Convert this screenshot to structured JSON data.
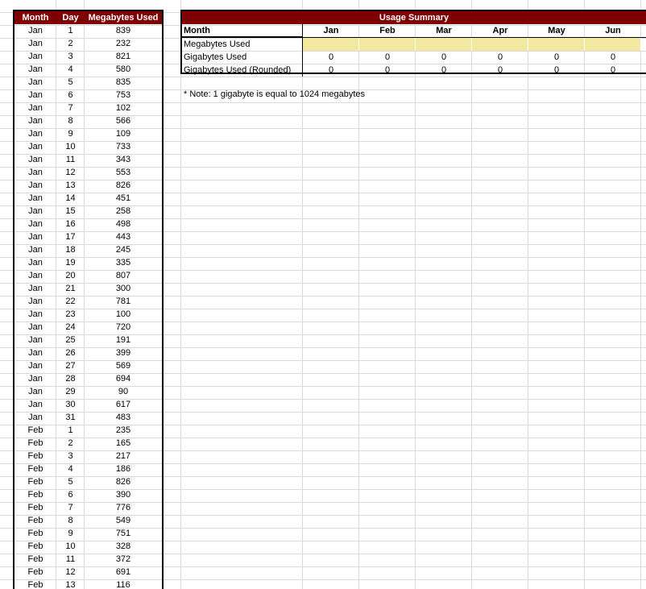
{
  "data_table": {
    "headers": {
      "month": "Month",
      "day": "Day",
      "megabytes": "Megabytes Used"
    },
    "rows": [
      [
        "Jan",
        "1",
        "839"
      ],
      [
        "Jan",
        "2",
        "232"
      ],
      [
        "Jan",
        "3",
        "821"
      ],
      [
        "Jan",
        "4",
        "580"
      ],
      [
        "Jan",
        "5",
        "835"
      ],
      [
        "Jan",
        "6",
        "753"
      ],
      [
        "Jan",
        "7",
        "102"
      ],
      [
        "Jan",
        "8",
        "566"
      ],
      [
        "Jan",
        "9",
        "109"
      ],
      [
        "Jan",
        "10",
        "733"
      ],
      [
        "Jan",
        "11",
        "343"
      ],
      [
        "Jan",
        "12",
        "553"
      ],
      [
        "Jan",
        "13",
        "826"
      ],
      [
        "Jan",
        "14",
        "451"
      ],
      [
        "Jan",
        "15",
        "258"
      ],
      [
        "Jan",
        "16",
        "498"
      ],
      [
        "Jan",
        "17",
        "443"
      ],
      [
        "Jan",
        "18",
        "245"
      ],
      [
        "Jan",
        "19",
        "335"
      ],
      [
        "Jan",
        "20",
        "807"
      ],
      [
        "Jan",
        "21",
        "300"
      ],
      [
        "Jan",
        "22",
        "781"
      ],
      [
        "Jan",
        "23",
        "100"
      ],
      [
        "Jan",
        "24",
        "720"
      ],
      [
        "Jan",
        "25",
        "191"
      ],
      [
        "Jan",
        "26",
        "399"
      ],
      [
        "Jan",
        "27",
        "569"
      ],
      [
        "Jan",
        "28",
        "694"
      ],
      [
        "Jan",
        "29",
        "90"
      ],
      [
        "Jan",
        "30",
        "617"
      ],
      [
        "Jan",
        "31",
        "483"
      ],
      [
        "Feb",
        "1",
        "235"
      ],
      [
        "Feb",
        "2",
        "165"
      ],
      [
        "Feb",
        "3",
        "217"
      ],
      [
        "Feb",
        "4",
        "186"
      ],
      [
        "Feb",
        "5",
        "826"
      ],
      [
        "Feb",
        "6",
        "390"
      ],
      [
        "Feb",
        "7",
        "776"
      ],
      [
        "Feb",
        "8",
        "549"
      ],
      [
        "Feb",
        "9",
        "751"
      ],
      [
        "Feb",
        "10",
        "328"
      ],
      [
        "Feb",
        "11",
        "372"
      ],
      [
        "Feb",
        "12",
        "691"
      ],
      [
        "Feb",
        "13",
        "116"
      ]
    ]
  },
  "summary": {
    "title": "Usage Summary",
    "month_label": "Month",
    "months": [
      "Jan",
      "Feb",
      "Mar",
      "Apr",
      "May",
      "Jun"
    ],
    "rows": [
      {
        "label": "Megabytes Used",
        "values": [
          "",
          "",
          "",
          "",
          "",
          ""
        ]
      },
      {
        "label": "Gigabytes Used",
        "values": [
          "0",
          "0",
          "0",
          "0",
          "0",
          "0"
        ]
      },
      {
        "label": "Gigabytes Used (Rounded)",
        "values": [
          "0",
          "0",
          "0",
          "0",
          "0",
          "0"
        ]
      }
    ]
  },
  "note": "* Note: 1 gigabyte is equal to 1024 megabytes",
  "colors": {
    "header_bg": "#7f0000",
    "input_fill": "#f2e8a0",
    "gridline": "#d9d9d9"
  }
}
